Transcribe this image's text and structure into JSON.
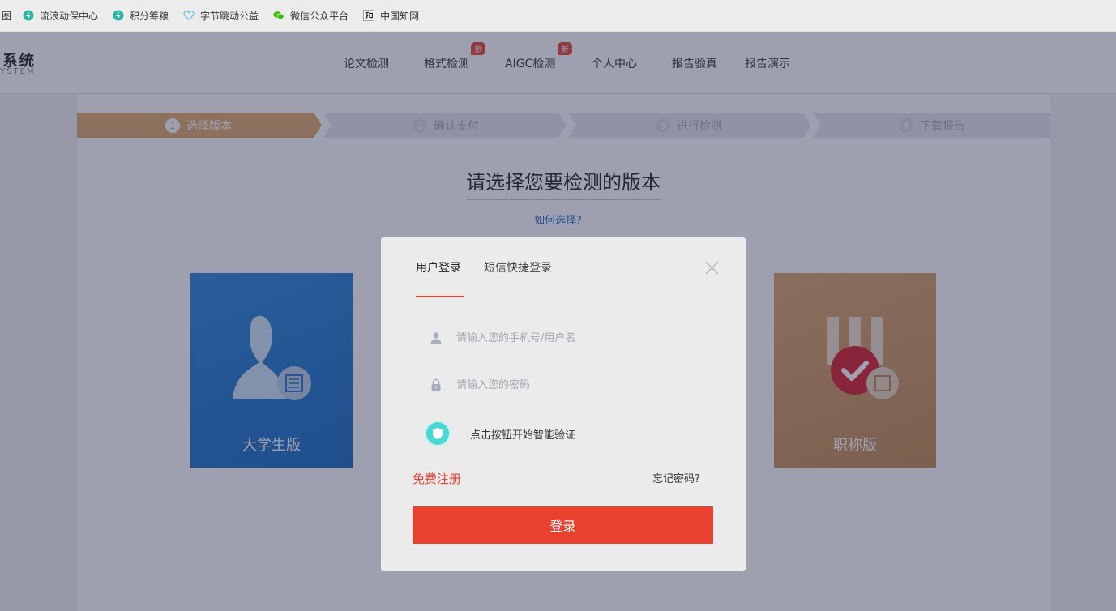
{
  "bookmarks": {
    "partial_first": "图",
    "items": [
      {
        "label": "流浪动保中心",
        "icon": "bolt-icon",
        "color": "#2bb4a8"
      },
      {
        "label": "积分筹粮",
        "icon": "bolt-icon",
        "color": "#2bb4a8"
      },
      {
        "label": "字节跳动公益",
        "icon": "heart-icon",
        "color": "#6ec6e6"
      },
      {
        "label": "微信公众平台",
        "icon": "wechat-icon",
        "color": "#2dc100"
      },
      {
        "label": "中国知网",
        "icon": "cnki-icon",
        "color": "#333333"
      }
    ]
  },
  "header": {
    "logo_cn": "系统",
    "logo_en": "YSTEM",
    "nav": [
      {
        "label": "论文检测"
      },
      {
        "label": "格式检测",
        "badge": "热"
      },
      {
        "label": "AIGC检测",
        "badge": "新"
      },
      {
        "label": "个人中心"
      },
      {
        "label": "报告验真"
      },
      {
        "label": "报告演示"
      }
    ]
  },
  "steps": [
    {
      "num": "1",
      "label": "选择版本",
      "active": true
    },
    {
      "num": "2",
      "label": "确认支付",
      "active": false
    },
    {
      "num": "3",
      "label": "进行检测",
      "active": false
    },
    {
      "num": "4",
      "label": "下载报告",
      "active": false
    }
  ],
  "main": {
    "title": "请选择您要检测的版本",
    "howto": "如何选择?",
    "cards": [
      {
        "label": "大学生版"
      },
      {
        "label": "职称版"
      }
    ]
  },
  "modal": {
    "tab_user": "用户登录",
    "tab_sms": "短信快捷登录",
    "username_placeholder": "请输入您的手机号/用户名",
    "password_placeholder": "请输入您的密码",
    "verify_text": "点击按钮开始智能验证",
    "register": "免费注册",
    "forgot": "忘记密码?",
    "login": "登录"
  },
  "colors": {
    "accent_red": "#e9402f",
    "step_active": "#e0a86a",
    "card_blue": "#1a6bc0",
    "card_gold": "#c28b4e",
    "verify_teal": "#4ad8d4"
  }
}
